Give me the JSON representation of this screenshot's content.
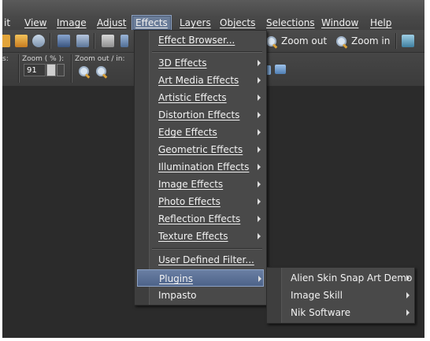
{
  "menubar": {
    "items": [
      "it",
      "View",
      "Image",
      "Adjust",
      "Effects",
      "Layers",
      "Objects",
      "Selections",
      "Window",
      "Help"
    ],
    "active": "Effects"
  },
  "toolbar": {
    "zoom_out_label": "Zoom out",
    "zoom_in_label": "Zoom in"
  },
  "toolbar2": {
    "zoom_label": "Zoom ( % ):",
    "zoom_out_in_label": "Zoom out / in:",
    "zoom_value": "91",
    "left_label": "s:"
  },
  "effects_menu": {
    "items": [
      {
        "label": "Effect Browser...",
        "submenu": false
      },
      {
        "label": "3D Effects",
        "submenu": true
      },
      {
        "label": "Art Media Effects",
        "submenu": true
      },
      {
        "label": "Artistic Effects",
        "submenu": true
      },
      {
        "label": "Distortion Effects",
        "submenu": true
      },
      {
        "label": "Edge Effects",
        "submenu": true
      },
      {
        "label": "Geometric Effects",
        "submenu": true
      },
      {
        "label": "Illumination Effects",
        "submenu": true
      },
      {
        "label": "Image Effects",
        "submenu": true
      },
      {
        "label": "Photo Effects",
        "submenu": true
      },
      {
        "label": "Reflection Effects",
        "submenu": true
      },
      {
        "label": "Texture Effects",
        "submenu": true
      },
      {
        "label": "User Defined Filter...",
        "submenu": false
      },
      {
        "label": "Plugins",
        "submenu": true,
        "highlighted": true
      },
      {
        "label": "Impasto",
        "submenu": false
      }
    ]
  },
  "plugins_submenu": {
    "items": [
      {
        "label": "Alien Skin Snap Art Demo",
        "submenu": true
      },
      {
        "label": "Image Skill",
        "submenu": true
      },
      {
        "label": "Nik Software",
        "submenu": true
      }
    ]
  }
}
